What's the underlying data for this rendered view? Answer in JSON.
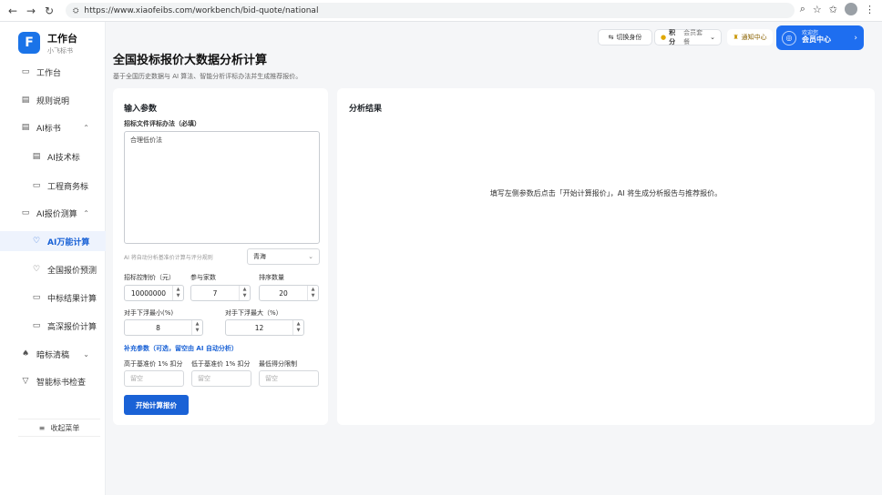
{
  "browser": {
    "url": "https://www.xiaofeibs.com/workbench/bid-quote/national",
    "back_icon": "←",
    "forward_icon": "→",
    "reload_icon": "↻"
  },
  "brand": {
    "title": "工作台",
    "subtitle": "小飞标书",
    "logo_letter": "F"
  },
  "sidebar": {
    "items": [
      {
        "label": "工作台",
        "icon": "monitor-icon",
        "glyph": "▭",
        "level": "top",
        "caret": ""
      },
      {
        "label": "规则说明",
        "icon": "document-icon",
        "glyph": "▤",
        "level": "top",
        "caret": ""
      },
      {
        "label": "AI标书",
        "icon": "file-icon",
        "glyph": "▤",
        "level": "top",
        "caret": "⌃"
      },
      {
        "label": "AI技术标",
        "icon": "file-icon",
        "glyph": "▤",
        "level": "sub",
        "caret": ""
      },
      {
        "label": "工程商务标",
        "icon": "folder-icon",
        "glyph": "▭",
        "level": "sub",
        "caret": "⌄"
      },
      {
        "label": "AI报价测算",
        "icon": "calculator-icon",
        "glyph": "▭",
        "level": "top",
        "caret": "⌃"
      },
      {
        "label": "AI万能计算",
        "icon": "chat-icon",
        "glyph": "♡",
        "level": "sub",
        "caret": "",
        "active": true
      },
      {
        "label": "全国报价预测",
        "icon": "chat-icon",
        "glyph": "♡",
        "level": "sub",
        "caret": ""
      },
      {
        "label": "中标结果计算",
        "icon": "chat-icon",
        "glyph": "▭",
        "level": "sub",
        "caret": ""
      },
      {
        "label": "高深报价计算",
        "icon": "chat-icon",
        "glyph": "▭",
        "level": "sub",
        "caret": ""
      },
      {
        "label": "暗标清稿",
        "icon": "rocket-icon",
        "glyph": "♠",
        "level": "top",
        "caret": "⌄"
      },
      {
        "label": "智能标书检查",
        "icon": "filter-icon",
        "glyph": "▽",
        "level": "top",
        "caret": ""
      }
    ],
    "collapse_label": "收起菜单",
    "collapse_icon": "≡"
  },
  "header": {
    "switch_identity": "切换身份",
    "points_badge": "积分",
    "points_sub": "会员套餐",
    "message_center": "通知中心",
    "vip_top": "欢迎您",
    "vip_main": "会员中心",
    "vip_arrow": "›"
  },
  "page": {
    "title": "全国投标报价大数据分析计算",
    "description": "基于全国历史数据与 AI 算法、智能分析评标办法并生成推荐报价。"
  },
  "form": {
    "title": "输入参数",
    "method_label": "招标文件评标办法（必填）",
    "method_value": "合理低价法",
    "hint": "AI 将自动分析基准价计算与评分规则",
    "region_value": "青海",
    "control_price_label": "招标控制价（元）",
    "control_price_value": "10000000",
    "bidders_label": "参与家数",
    "bidders_value": "7",
    "simulations_label": "排序数量",
    "simulations_value": "20",
    "float_min_label": "对手下浮最小(%)",
    "float_min_value": "8",
    "float_max_label": "对手下浮最大（%）",
    "float_max_value": "12",
    "supplement_label": "补充参数（可选，留空由 AI 自动分析）",
    "above_label": "高于基准价 1% 扣分",
    "below_label": "低于基准价 1% 扣分",
    "min_score_label": "最低得分限制",
    "placeholder": "留空",
    "submit_label": "开始计算报价"
  },
  "results": {
    "title": "分析结果",
    "empty_message": "填写左侧参数后点击「开始计算报价」，AI 将生成分析报告与推荐报价。"
  }
}
